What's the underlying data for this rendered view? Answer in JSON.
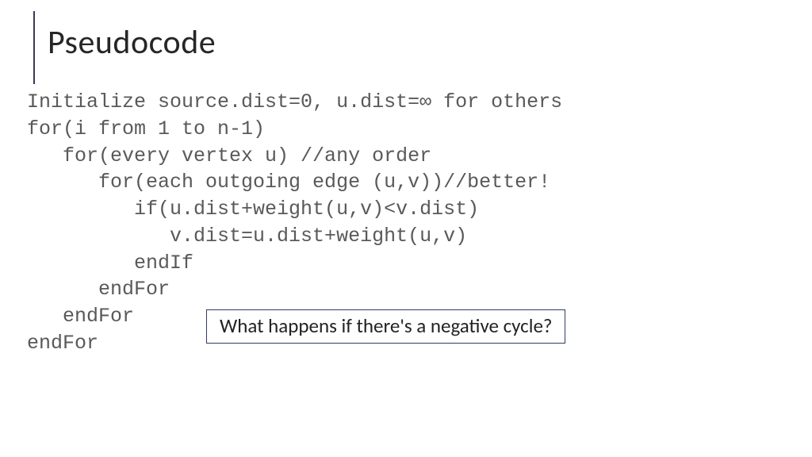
{
  "title": "Pseudocode",
  "code": "Initialize source.dist=0, u.dist=∞ for others\nfor(i from 1 to n-1)\n   for(every vertex u) //any order\n      for(each outgoing edge (u,v))//better!\n         if(u.dist+weight(u,v)<v.dist)\n            v.dist=u.dist+weight(u,v)\n         endIf\n      endFor\n   endFor\nendFor",
  "callout": "What happens if there's a negative cycle?"
}
